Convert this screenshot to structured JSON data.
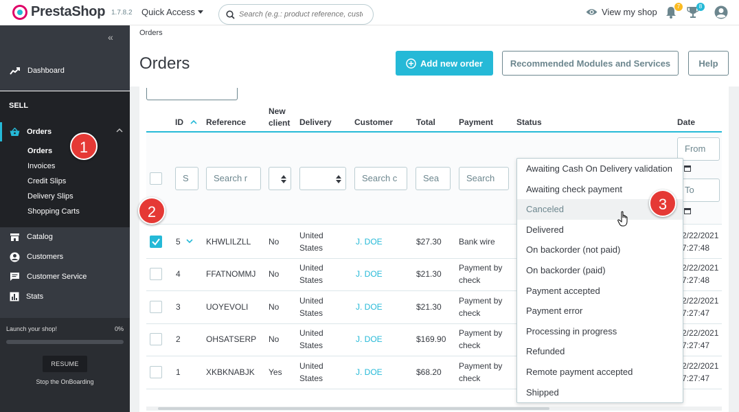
{
  "header": {
    "logo_text": "PrestaShop",
    "version": "1.7.8.2",
    "quick_access": "Quick Access",
    "search_placeholder": "Search (e.g.: product reference, custon",
    "view_shop": "View my shop",
    "notifications_count": "7",
    "trophy_count": "8",
    "colors": {
      "accent": "#25b9d7",
      "notif_badge": "#fbbb22",
      "trophy_badge": "#25b9d7"
    }
  },
  "sidebar": {
    "dashboard": "Dashboard",
    "sell_title": "SELL",
    "orders": "Orders",
    "orders_sub": [
      "Orders",
      "Invoices",
      "Credit Slips",
      "Delivery Slips",
      "Shopping Carts"
    ],
    "items": [
      "Catalog",
      "Customers",
      "Customer Service",
      "Stats"
    ],
    "launch_label": "Launch your shop!",
    "launch_pct": "0%",
    "launch_progress": 0,
    "resume": "RESUME",
    "stop_onboarding": "Stop the OnBoarding"
  },
  "page": {
    "breadcrumb": "Orders",
    "title": "Orders",
    "add_order": "Add new order",
    "recommended": "Recommended Modules and Services",
    "help": "Help"
  },
  "table": {
    "headers": {
      "id": "ID",
      "reference": "Reference",
      "new_client_1": "New",
      "new_client_2": "client",
      "delivery": "Delivery",
      "customer": "Customer",
      "total": "Total",
      "payment": "Payment",
      "status": "Status",
      "date": "Date"
    },
    "filters": {
      "id": "S",
      "reference": "Search r",
      "customer": "Search c",
      "total": "Sea",
      "payment": "Search",
      "date_from": "From",
      "date_to": "To"
    },
    "rows": [
      {
        "id": "5",
        "ref": "KHWLILZLL",
        "new": "No",
        "delivery_1": "United",
        "delivery_2": "States",
        "customer": "J. DOE",
        "total": "$27.30",
        "payment_1": "Bank wire",
        "payment_2": "",
        "date_1": "2/22/2021",
        "date_2": "7:27:48",
        "checked": true
      },
      {
        "id": "4",
        "ref": "FFATNOMMJ",
        "new": "No",
        "delivery_1": "United",
        "delivery_2": "States",
        "customer": "J. DOE",
        "total": "$21.30",
        "payment_1": "Payment by",
        "payment_2": "check",
        "date_1": "2/22/2021",
        "date_2": "7:27:48",
        "checked": false
      },
      {
        "id": "3",
        "ref": "UOYEVOLI",
        "new": "No",
        "delivery_1": "United",
        "delivery_2": "States",
        "customer": "J. DOE",
        "total": "$21.30",
        "payment_1": "Payment by",
        "payment_2": "check",
        "date_1": "2/22/2021",
        "date_2": "7:27:47",
        "checked": false
      },
      {
        "id": "2",
        "ref": "OHSATSERP",
        "new": "No",
        "delivery_1": "United",
        "delivery_2": "States",
        "customer": "J. DOE",
        "total": "$169.90",
        "payment_1": "Payment by",
        "payment_2": "check",
        "date_1": "2/22/2021",
        "date_2": "7:27:47",
        "checked": false
      },
      {
        "id": "1",
        "ref": "XKBKNABJK",
        "new": "Yes",
        "delivery_1": "United",
        "delivery_2": "States",
        "customer": "J. DOE",
        "total": "$68.20",
        "payment_1": "Payment by",
        "payment_2": "check",
        "date_1": "2/22/2021",
        "date_2": "7:27:47",
        "checked": false
      }
    ]
  },
  "status_dropdown": {
    "options": [
      "Awaiting Cash On Delivery validation",
      "Awaiting check payment",
      "Canceled",
      "Delivered",
      "On backorder (not paid)",
      "On backorder (paid)",
      "Payment accepted",
      "Payment error",
      "Processing in progress",
      "Refunded",
      "Remote payment accepted",
      "Shipped"
    ],
    "hovered": "Canceled"
  },
  "callouts": [
    "1",
    "2",
    "3"
  ]
}
